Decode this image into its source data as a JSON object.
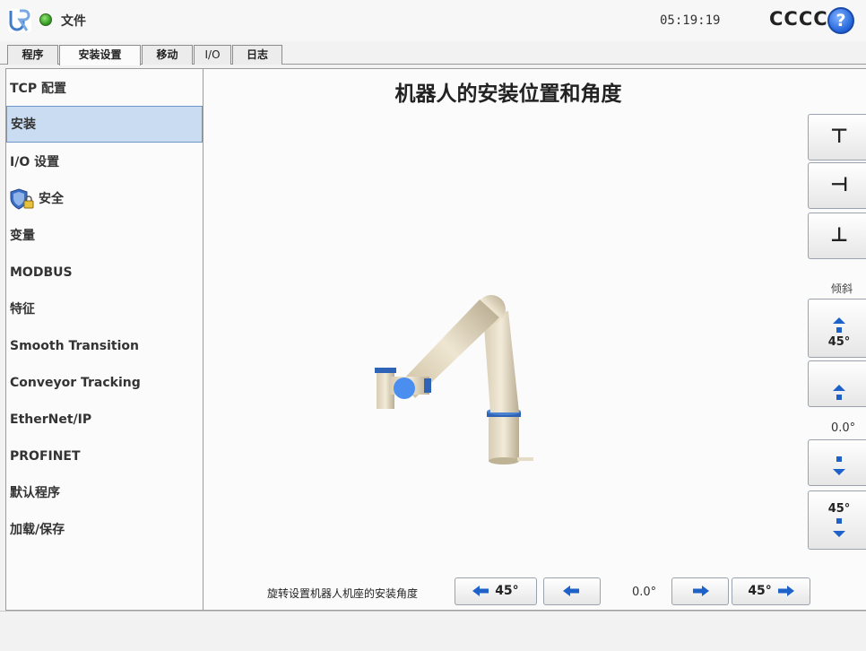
{
  "header": {
    "file_menu": "文件",
    "clock": "05:19:19",
    "robot_name": "CCCC",
    "help_label": "?"
  },
  "tabs": [
    {
      "label": "程序"
    },
    {
      "label": "安装设置"
    },
    {
      "label": "移动"
    },
    {
      "label": "I/O"
    },
    {
      "label": "日志"
    }
  ],
  "active_tab": "安装设置",
  "sidebar": {
    "items": [
      {
        "label": "TCP 配置"
      },
      {
        "label": "安装"
      },
      {
        "label": "I/O 设置"
      },
      {
        "label": "安全"
      },
      {
        "label": "变量"
      },
      {
        "label": "MODBUS"
      },
      {
        "label": "特征"
      },
      {
        "label": "Smooth Transition"
      },
      {
        "label": "Conveyor Tracking"
      },
      {
        "label": "EtherNet/IP"
      },
      {
        "label": "PROFINET"
      },
      {
        "label": "默认程序"
      },
      {
        "label": "加载/保存"
      }
    ],
    "selected": "安装"
  },
  "main": {
    "title": "机器人的安装位置和角度",
    "mount_buttons": [
      {
        "glyph": "⊤"
      },
      {
        "glyph": "⊣"
      },
      {
        "glyph": "⊥"
      }
    ],
    "tilt": {
      "label": "倾斜",
      "up_45_label": "45°",
      "value": "0.0°",
      "down_45_label": "45°"
    },
    "rotation": {
      "label": "旋转设置机器人机座的安装角度",
      "left_45_label": "45°",
      "value": "0.0°",
      "right_45_label": "45°"
    }
  },
  "colors": {
    "accent_blue": "#1e62c9",
    "selected_bg": "#c9dcf2",
    "status_green": "#2e8f1f"
  }
}
